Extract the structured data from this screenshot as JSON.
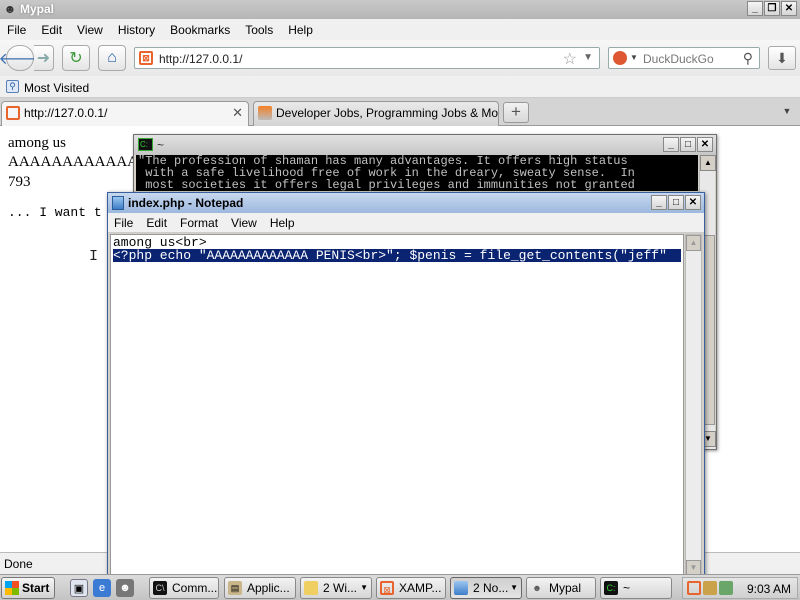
{
  "browser": {
    "title": "Mypal",
    "menu": [
      "File",
      "Edit",
      "View",
      "History",
      "Bookmarks",
      "Tools",
      "Help"
    ],
    "url": "http://127.0.0.1/",
    "search_placeholder": "DuckDuckGo",
    "bookmarks": {
      "label": "Most Visited"
    },
    "tabs": [
      {
        "label": "http://127.0.0.1/"
      },
      {
        "label": "Developer Jobs, Programming Jobs & Mo..."
      }
    ],
    "status": "Done"
  },
  "page": {
    "line1": "among us",
    "line2": "AAAAAAAAAAAA",
    "line3": "793",
    "line4": "... I want t"
  },
  "terminal": {
    "title": "~",
    "lines": [
      "\"The profession of shaman has many advantages. It offers high status",
      " with a safe livelihood free of work in the dreary, sweaty sense.  In",
      " most societies it offers legal privileges and immunities not granted"
    ]
  },
  "notepad": {
    "title": "index.php - Notepad",
    "menu": [
      "File",
      "Edit",
      "Format",
      "View",
      "Help"
    ],
    "line1": "among us<br>",
    "line2_selected": "<?php echo \"AAAAAAAAAAAAA PENIS<br>\"; $penis = file_get_contents(\"jeff\""
  },
  "taskbar": {
    "start": "Start",
    "buttons": [
      {
        "label": "Comm..."
      },
      {
        "label": "Applic..."
      },
      {
        "label": "2 Wi..."
      },
      {
        "label": "XAMP..."
      },
      {
        "label": "2 No..."
      },
      {
        "label": "Mypal"
      },
      {
        "label": "~"
      }
    ],
    "clock": "9:03 AM"
  },
  "colors": {
    "selection": "#0a2472",
    "firefox_orange": "#e9642c",
    "terminal_bg": "#000000"
  }
}
